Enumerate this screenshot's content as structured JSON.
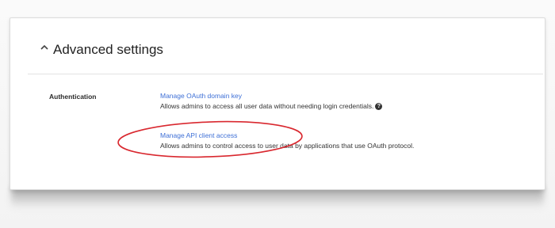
{
  "section": {
    "title": "Advanced settings",
    "expanded": true,
    "chevron_icon": "chevron-up-icon"
  },
  "authentication": {
    "label": "Authentication",
    "items": [
      {
        "link": "Manage OAuth domain key",
        "description": "Allows admins to access all user data without needing login credentials.",
        "help_icon": "question-circle-icon"
      },
      {
        "link": "Manage API client access",
        "description": "Allows admins to control access to user data by applications that use OAuth protocol.",
        "highlighted": true
      }
    ]
  },
  "colors": {
    "link": "#3d6fd6",
    "annotation_circle": "#d9282f",
    "title_text": "#222222"
  }
}
